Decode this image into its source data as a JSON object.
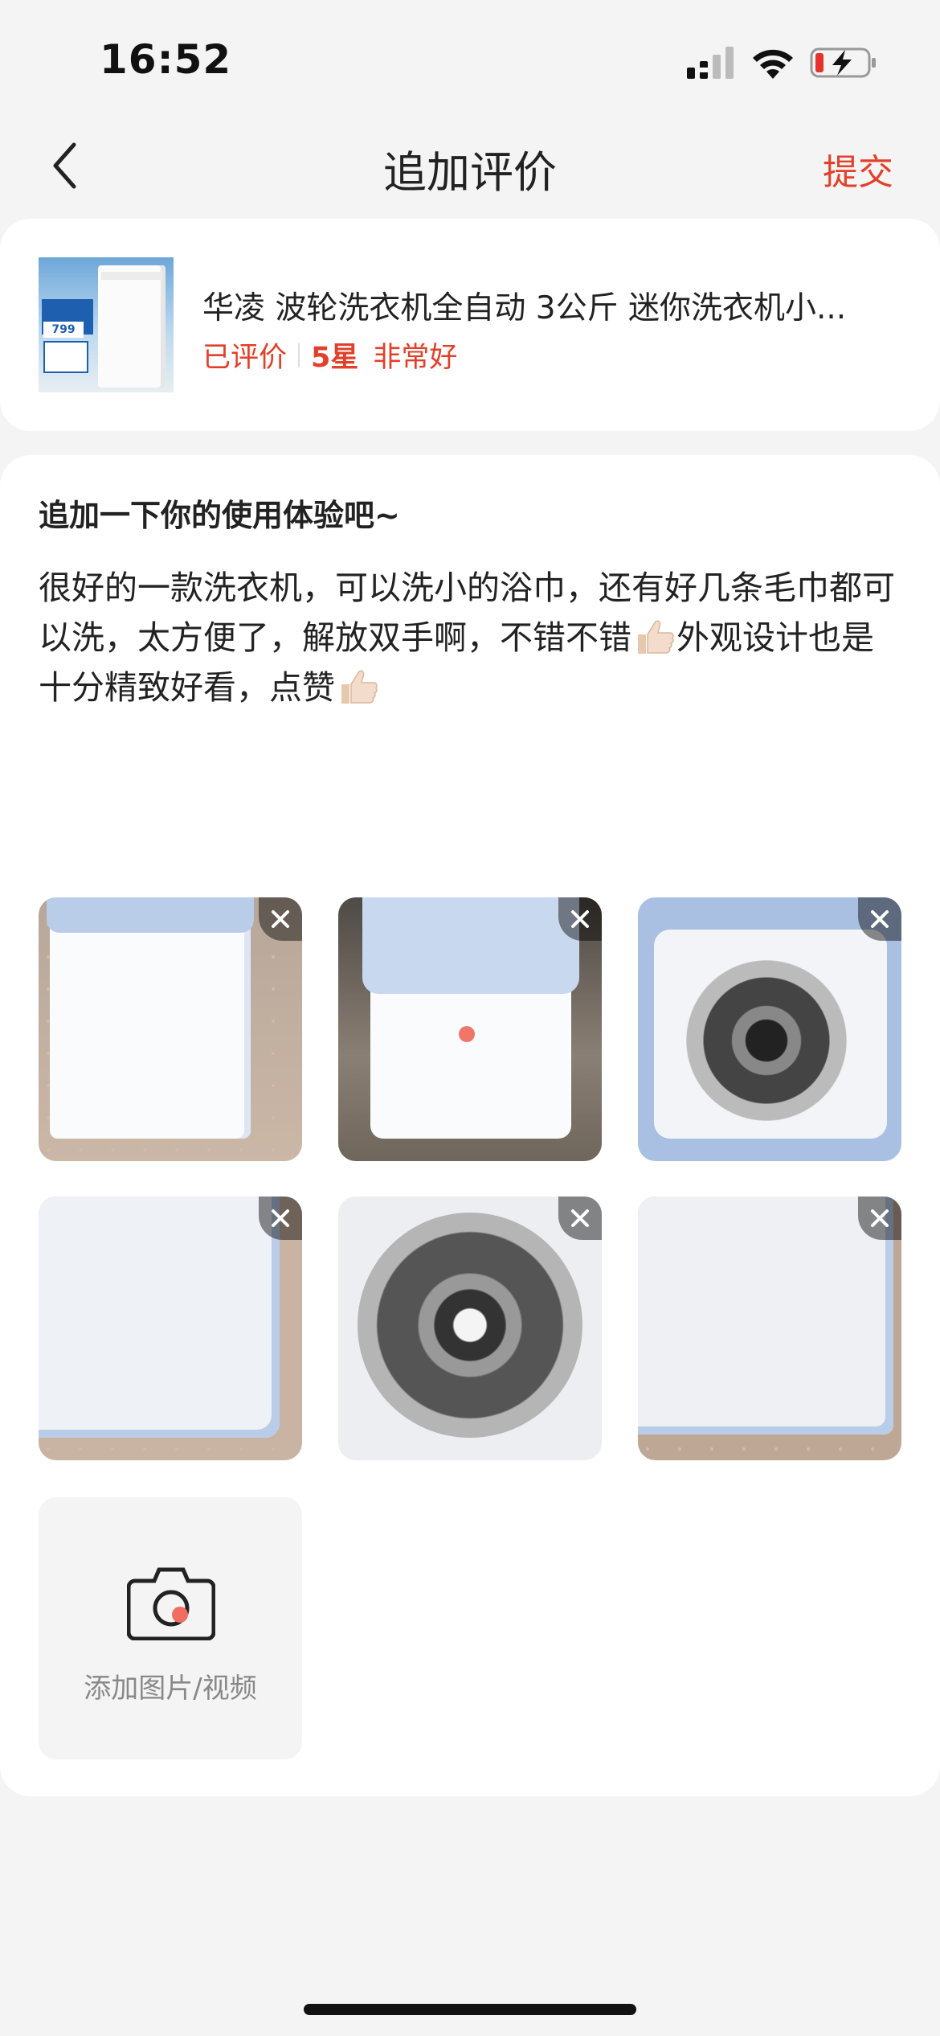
{
  "status_bar": {
    "time": "16:52"
  },
  "nav": {
    "title": "追加评价",
    "submit_label": "提交"
  },
  "product": {
    "title": "华凌 波轮洗衣机全自动 3公斤 迷你洗衣机小...",
    "status": "已评价",
    "stars": "5星",
    "rating_text": "非常好",
    "thumbnail": {
      "price": "799"
    }
  },
  "review": {
    "prompt": "追加一下你的使用体验吧~",
    "text_part1": "很好的一款洗衣机，可以洗小的浴巾，还有好几条毛巾都可以洗，太方便了，解放双手啊，不错不错",
    "text_part2": "外观设计也是十分精致好看，点赞",
    "emoji": "thumbs-up-icon"
  },
  "photos": [
    {
      "description_icon": "washing-machine-photo"
    },
    {
      "description_icon": "washing-machine-photo"
    },
    {
      "description_icon": "washing-machine-drum-photo"
    },
    {
      "description_icon": "washing-machine-lid-photo"
    },
    {
      "description_icon": "washing-machine-drum-photo"
    },
    {
      "description_icon": "washing-machine-lid-photo"
    }
  ],
  "add_media": {
    "label": "添加图片/视频"
  },
  "colors": {
    "accent": "#e1402a",
    "background": "#f4f4f4",
    "card": "#ffffff"
  }
}
